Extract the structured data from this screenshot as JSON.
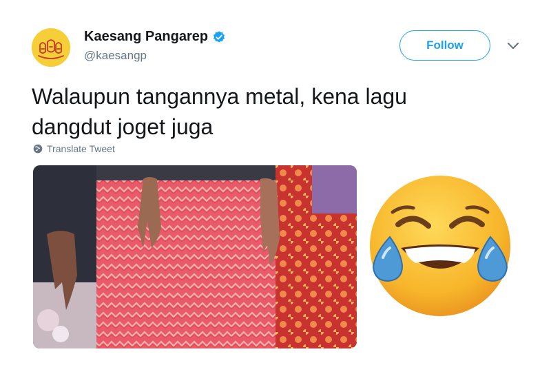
{
  "author": {
    "name": "Kaesang Pangarep",
    "handle": "@kaesangp",
    "verified_icon": "verified-badge-icon"
  },
  "follow": {
    "label": "Follow"
  },
  "tweet": {
    "text": "Walaupun tangannya metal, kena lagu dangdut joget juga"
  },
  "translate": {
    "label": "Translate Tweet",
    "icon": "globe-icon"
  },
  "media": {
    "type": "photo"
  },
  "overlay": {
    "emoji": "face-with-tears-of-joy-icon"
  },
  "colors": {
    "accent": "#1da1f2",
    "secondary_text": "#657786",
    "primary_text": "#14171a"
  }
}
